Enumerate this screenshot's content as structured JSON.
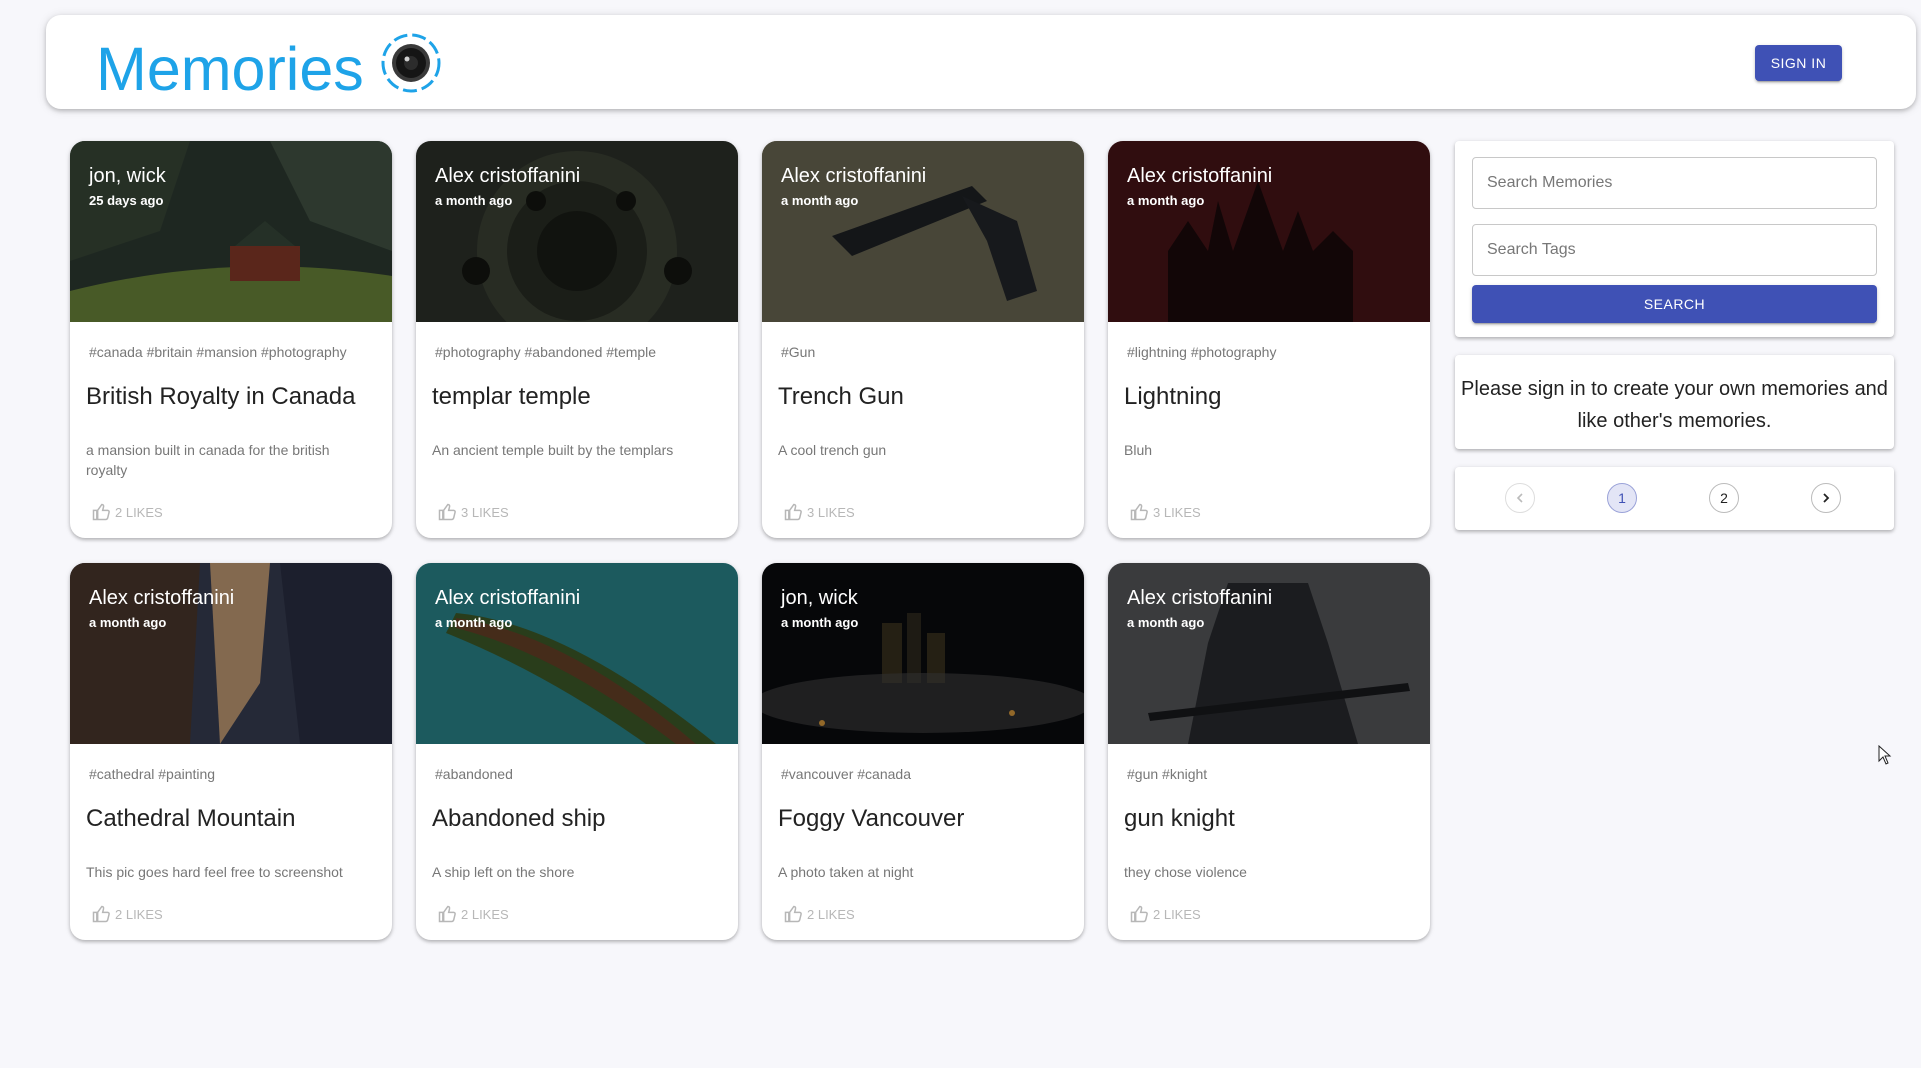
{
  "header": {
    "title": "Memories",
    "sign_in_label": "SIGN IN",
    "brand_color": "#1ea3e8",
    "accent_color": "#3f51b5"
  },
  "posts": [
    {
      "author": "jon, wick",
      "time": "25 days ago",
      "tags": "#canada #britain #mansion #photography",
      "title": "British Royalty in Canada",
      "description": "a mansion built in canada for the british royalty",
      "likes": "2 LIKES",
      "image": "mansion-on-hill"
    },
    {
      "author": "Alex cristoffanini",
      "time": "a month ago",
      "tags": "#photography #abandoned #temple",
      "title": "templar temple",
      "description": "An ancient temple built by the templars",
      "likes": "3 LIKES",
      "image": "spiral-well"
    },
    {
      "author": "Alex cristoffanini",
      "time": "a month ago",
      "tags": "#Gun",
      "title": "Trench Gun",
      "description": "A cool trench gun",
      "likes": "3 LIKES",
      "image": "shotgun"
    },
    {
      "author": "Alex cristoffanini",
      "time": "a month ago",
      "tags": "#lightning #photography",
      "title": "Lightning",
      "description": "Bluh",
      "likes": "3 LIKES",
      "image": "dark-castle"
    },
    {
      "author": "Alex cristoffanini",
      "time": "a month ago",
      "tags": "#cathedral #painting",
      "title": "Cathedral Mountain",
      "description": "This pic goes hard feel free to screenshot",
      "likes": "2 LIKES",
      "image": "cathedral-cliff"
    },
    {
      "author": "Alex cristoffanini",
      "time": "a month ago",
      "tags": "#abandoned",
      "title": "Abandoned ship",
      "description": "A ship left on the shore",
      "likes": "2 LIKES",
      "image": "overgrown-ship"
    },
    {
      "author": "jon, wick",
      "time": "a month ago",
      "tags": "#vancouver #canada",
      "title": "Foggy Vancouver",
      "description": "A photo taken at night",
      "likes": "2 LIKES",
      "image": "foggy-city-night"
    },
    {
      "author": "Alex cristoffanini",
      "time": "a month ago",
      "tags": "#gun #knight",
      "title": "gun knight",
      "description": "they chose violence",
      "likes": "2 LIKES",
      "image": "armored-knight"
    }
  ],
  "search": {
    "memories_placeholder": "Search Memories",
    "tags_placeholder": "Search Tags",
    "button_label": "SEARCH"
  },
  "notice": "Please sign in to create your own memories and like other's memories.",
  "pagination": {
    "pages": [
      "1",
      "2"
    ],
    "current": "1",
    "prev_icon": "chevron-left-icon",
    "next_icon": "chevron-right-icon"
  }
}
